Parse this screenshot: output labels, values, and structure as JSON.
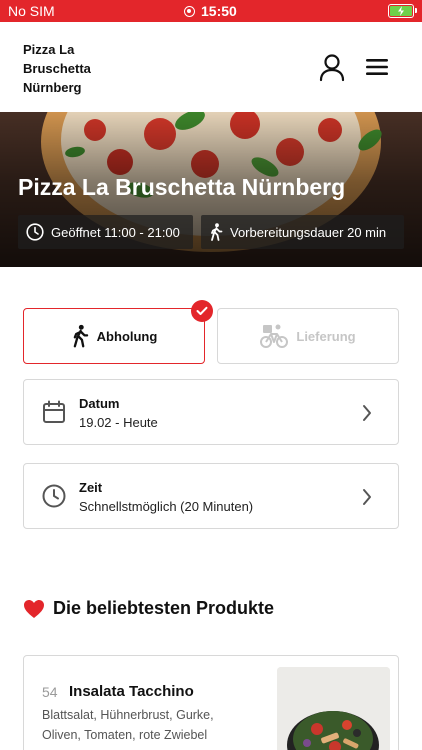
{
  "status_bar": {
    "carrier": "No SIM",
    "time": "15:50"
  },
  "header": {
    "restaurant_name": "Pizza La Bruschetta Nürnberg"
  },
  "hero": {
    "title": "Pizza La Bruschetta Nürnberg",
    "opening_hours": "Geöffnet 11:00 - 21:00",
    "preparation_time": "Vorbereitungsdauer 20 min"
  },
  "order_mode": {
    "pickup_label": "Abholung",
    "delivery_label": "Lieferung",
    "selected": "pickup"
  },
  "date_selector": {
    "label": "Datum",
    "value": "19.02 - Heute"
  },
  "time_selector": {
    "label": "Zeit",
    "value": "Schnellstmöglich (20 Minuten)"
  },
  "popular": {
    "title": "Die beliebtesten Produkte",
    "products": [
      {
        "number": "54",
        "name": "Insalata Tacchino",
        "description": "Blattsalat, Hühnerbrust, Gurke, Oliven, Tomaten, rote Zwiebel"
      }
    ]
  },
  "colors": {
    "accent": "#e3262b",
    "border": "#d8d8d8",
    "disabled_text": "#c6c6c6"
  },
  "icons": {
    "user": "user-icon",
    "menu": "hamburger-menu-icon",
    "clock": "clock-icon",
    "walk": "walking-person-icon",
    "bike": "bike-courier-icon",
    "calendar": "calendar-icon",
    "chevron": "chevron-right-icon",
    "check": "check-icon",
    "heart": "heart-icon"
  }
}
